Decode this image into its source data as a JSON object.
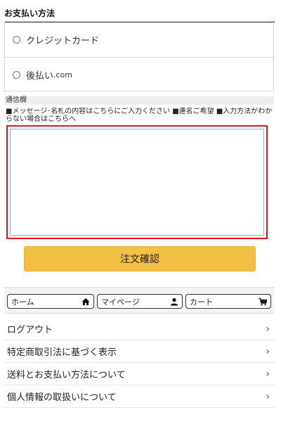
{
  "payment": {
    "title": "お支払い方法",
    "options": [
      {
        "label": "クレジットカード",
        "suffix": ""
      },
      {
        "label": "後払い",
        "suffix": ".com"
      }
    ]
  },
  "message": {
    "heading": "通信欄",
    "note": "■メッセージ･名札の内容はこちらにご入力ください ■連名ご希望 ■入力方法がわからない場合はこちらへ",
    "value": ""
  },
  "confirm": {
    "label": "注文確認"
  },
  "nav": {
    "home": "ホーム",
    "mypage": "マイページ",
    "cart": "カート"
  },
  "links": [
    {
      "label": "ログアウト"
    },
    {
      "label": "特定商取引法に基づく表示"
    },
    {
      "label": "送料とお支払い方法について"
    },
    {
      "label": "個人情報の取扱いについて"
    }
  ],
  "colors": {
    "confirm_button": "#f2c045",
    "highlight_border": "#e0141e"
  }
}
